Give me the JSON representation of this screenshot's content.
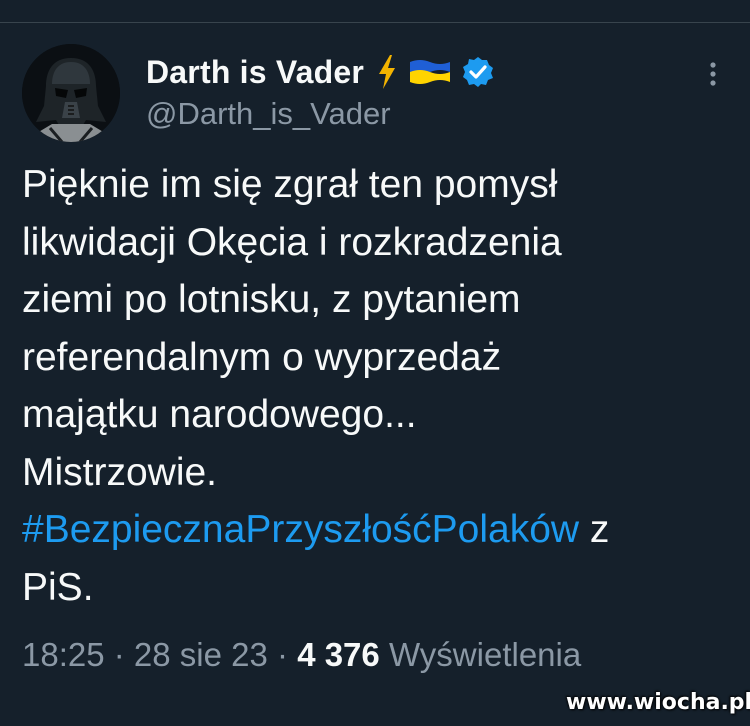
{
  "tweet": {
    "author": {
      "display_name": "Darth is Vader",
      "handle": "@Darth_is_Vader",
      "avatar_icon": "darth-vader-helmet-icon",
      "badges": [
        "lightning-bolt-icon",
        "ukraine-flag-icon",
        "verified-badge-icon"
      ]
    },
    "text_lines": [
      "Pięknie im się zgrał ten pomysł",
      "likwidacji Okęcia i rozkradzenia",
      "ziemi po lotnisku, z pytaniem",
      "referendalnym o wyprzedaż",
      "majątku narodowego...",
      "Mistrzowie."
    ],
    "hashtag": "#BezpiecznaPrzyszłośćPolaków",
    "after_hashtag": " z",
    "last_line": "PiS.",
    "time": "18:25",
    "separator": " · ",
    "date": "28 sie 23",
    "views_count": "4 376",
    "views_label": " Wyświetlenia"
  },
  "colors": {
    "background": "#15202b",
    "text": "#f7f9f9",
    "secondary": "#8b98a5",
    "link": "#1d9bf0",
    "verified": "#1d9bf0",
    "bolt": "#f4b400"
  },
  "watermark": "www.wiocha.pl"
}
